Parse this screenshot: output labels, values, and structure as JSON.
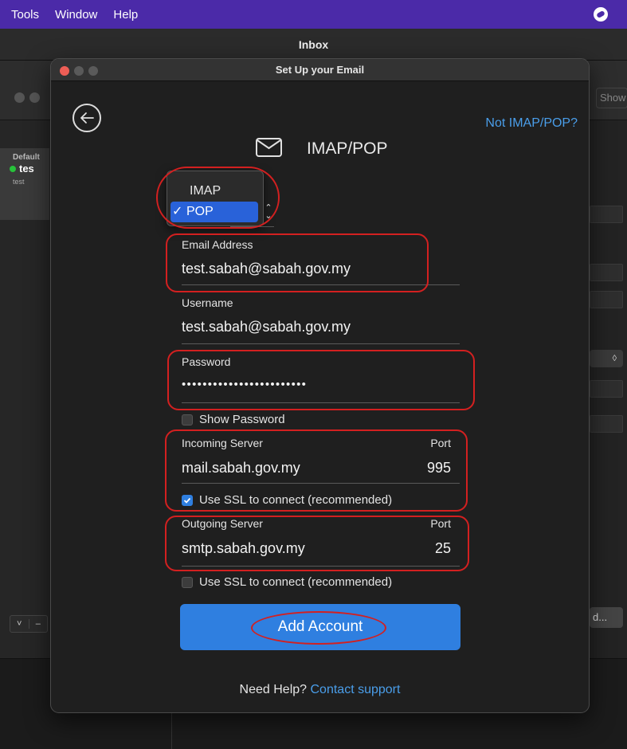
{
  "menubar": {
    "items": [
      "Tools",
      "Window",
      "Help"
    ]
  },
  "background": {
    "window_title": "Inbox",
    "sidebar_account": {
      "group": "Default",
      "name": "tes",
      "subtitle": "test"
    },
    "show_button": "Show",
    "bottom_button": "d...",
    "stepper_glyph": "◊",
    "footer_controls": [
      "˅",
      "–"
    ]
  },
  "dialog": {
    "title": "Set Up your Email",
    "not_imap_link": "Not IMAP/POP?",
    "heading": "IMAP/POP",
    "account_type": {
      "options": [
        "IMAP",
        "POP"
      ],
      "selected": "POP",
      "check": "✓"
    },
    "fields": {
      "email": {
        "label": "Email Address",
        "value": "test.sabah@sabah.gov.my"
      },
      "username": {
        "label": "Username",
        "value": "test.sabah@sabah.gov.my"
      },
      "password": {
        "label": "Password",
        "value": "••••••••••••••••••••••••",
        "show_label": "Show Password",
        "show_checked": false
      },
      "incoming": {
        "label": "Incoming Server",
        "value": "mail.sabah.gov.my",
        "port_label": "Port",
        "port": "995",
        "ssl_label": "Use SSL to connect (recommended)",
        "ssl_checked": true
      },
      "outgoing": {
        "label": "Outgoing Server",
        "value": "smtp.sabah.gov.my",
        "port_label": "Port",
        "port": "25",
        "ssl_label": "Use SSL to connect (recommended)",
        "ssl_checked": false
      }
    },
    "add_button": "Add Account",
    "help": {
      "prefix": "Need Help?",
      "link": "Contact support"
    }
  },
  "colors": {
    "menubar": "#4b2aa8",
    "accent": "#2f7fe0",
    "link": "#4a9eea",
    "annotation": "#d32020",
    "close_light": "#ee5e56"
  }
}
